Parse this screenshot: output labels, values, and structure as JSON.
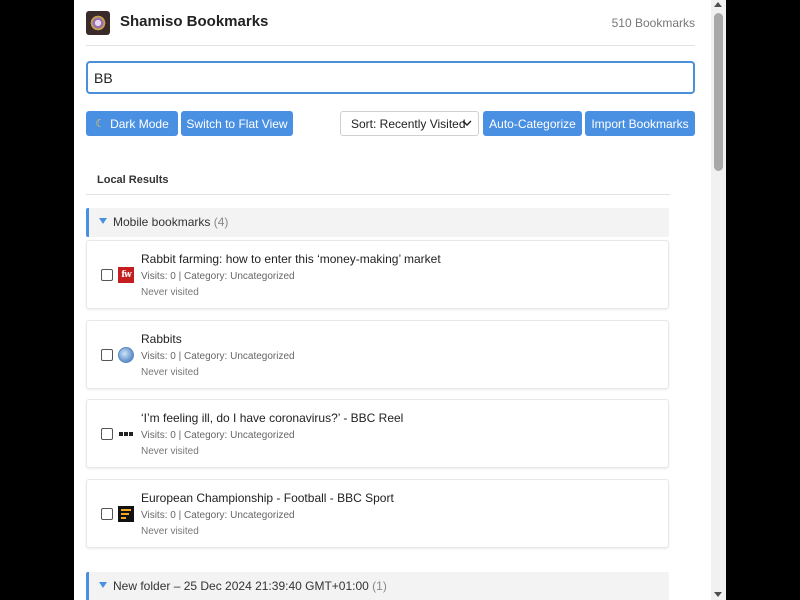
{
  "header": {
    "title": "Shamiso Bookmarks",
    "count": "510 Bookmarks",
    "logo_icon": "app-logo-icon"
  },
  "search": {
    "value": "BB"
  },
  "toolbar": {
    "dark_mode_label": "Dark Mode",
    "dark_mode_icon": "moon-icon",
    "flat_view_label": "Switch to Flat View",
    "sort_label": "Sort: Recently Visited",
    "auto_categorize_label": "Auto-Categorize",
    "import_label": "Import Bookmarks"
  },
  "results": {
    "section_title": "Local Results",
    "folders": [
      {
        "name": "Mobile bookmarks",
        "count": "(4)",
        "items": [
          {
            "title": "Rabbit farming: how to enter this ‘money-making’ market",
            "meta": "Visits: 0 | Category: Uncategorized",
            "visited": "Never visited",
            "favicon": "farmers-weekly-icon"
          },
          {
            "title": "Rabbits",
            "meta": "Visits: 0 | Category: Uncategorized",
            "visited": "Never visited",
            "favicon": "globe-icon"
          },
          {
            "title": "‘I’m feeling ill, do I have coronavirus?’ - BBC Reel",
            "meta": "Visits: 0 | Category: Uncategorized",
            "visited": "Never visited",
            "favicon": "bbc-icon"
          },
          {
            "title": "European Championship - Football - BBC Sport",
            "meta": "Visits: 0 | Category: Uncategorized",
            "visited": "Never visited",
            "favicon": "bbc-sport-icon"
          }
        ]
      },
      {
        "name": "New folder – 25 Dec 2024 21:39:40 GMT+01:00",
        "count": "(1)"
      }
    ]
  },
  "colors": {
    "accent": "#4a90e2",
    "favicon_fw": "#c41e1e",
    "sport_accent": "#f5a623"
  }
}
